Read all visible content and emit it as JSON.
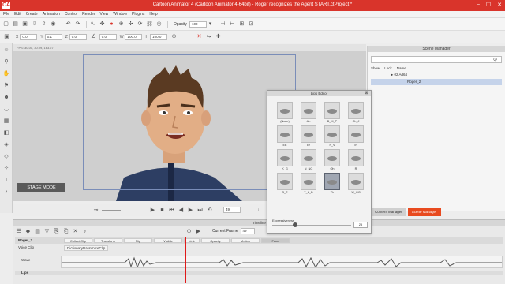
{
  "window": {
    "title": "Cartoon Animator 4  (Cartoon Animator 4-64bit) - Roger recognizes the Agent START.ctProject *",
    "app_icon": "CA"
  },
  "menu": [
    "File",
    "Edit",
    "Create",
    "Animation",
    "Control",
    "Render",
    "View",
    "Window",
    "Plugins",
    "Help"
  ],
  "toolbar": {
    "opacity_label": "Opacity",
    "opacity_value": "100"
  },
  "transform": {
    "x_label": "X",
    "x_value": "0.0",
    "y_label": "Y",
    "y_value": "0.1",
    "z_label": "Z",
    "z_value": "0.0",
    "angle_value": "0.0",
    "w_label": "W",
    "w_value": "100.0",
    "h_label": "H",
    "h_value": "100.0"
  },
  "stage": {
    "info": "FPS: 30.00, 30.09, 163.27",
    "mode_label": "STAGE MODE"
  },
  "playback": {
    "frame_value": "49"
  },
  "scene_manager": {
    "title": "Scene Manager",
    "columns": [
      "Show",
      "Lock",
      "Name"
    ],
    "items": [
      "02 Ad64",
      "Roger_2"
    ]
  },
  "tabs": {
    "content_manager": "Content Manager",
    "scene_manager": "Scene Manager"
  },
  "lips_editor": {
    "title": "Lips Editor",
    "visemes": [
      {
        "label": "(None)",
        "selected": false
      },
      {
        "label": "Ah",
        "selected": false
      },
      {
        "label": "B_M_P",
        "selected": false
      },
      {
        "label": "Ch_J",
        "selected": false
      },
      {
        "label": "EE",
        "selected": false
      },
      {
        "label": "Er",
        "selected": false
      },
      {
        "label": "F_V",
        "selected": false
      },
      {
        "label": "Ih",
        "selected": false
      },
      {
        "label": "K_G",
        "selected": false
      },
      {
        "label": "N_NG",
        "selected": false
      },
      {
        "label": "Oh",
        "selected": false
      },
      {
        "label": "R",
        "selected": false
      },
      {
        "label": "S_Z",
        "selected": false
      },
      {
        "label": "T_L_D",
        "selected": false
      },
      {
        "label": "Th",
        "selected": true
      },
      {
        "label": "W_OO",
        "selected": false
      }
    ],
    "expressiveness_label": "Expressiveness",
    "expressiveness_value": "25"
  },
  "timeline": {
    "title": "Timeline",
    "current_frame_label": "Current Frame",
    "current_frame_value": "49",
    "track_name": "Roger_2",
    "track_tabs": [
      "Collect Clip",
      "Transform",
      "Flip",
      "Visible",
      "Link",
      "Opacity",
      "Motion",
      "Face"
    ],
    "active_tab": "Face",
    "voice_clip_label": "Voice Clip",
    "voice_clip_name": "DictionaryDataVoiceClip",
    "wave_label": "Wave",
    "lips_label": "Lips"
  }
}
